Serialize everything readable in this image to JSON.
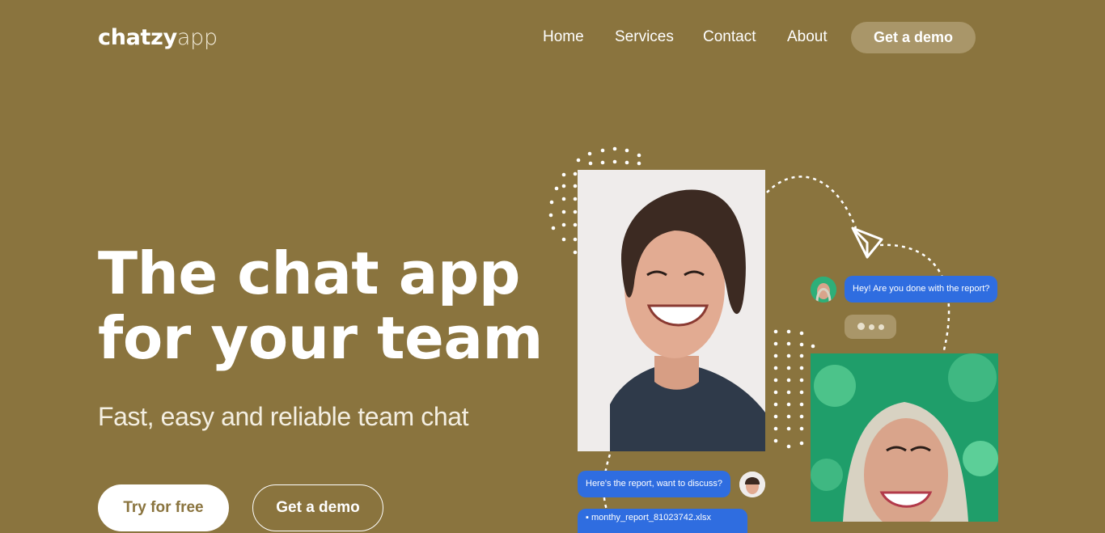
{
  "logo": {
    "bold": "chatzy",
    "light": "app"
  },
  "nav": {
    "links": [
      "Home",
      "Services",
      "Contact",
      "About"
    ],
    "cta": "Get a demo"
  },
  "hero": {
    "title_line1": "The chat app",
    "title_line2": "for your team",
    "subtitle": "Fast, easy and reliable team chat",
    "primary_button": "Try for free",
    "secondary_button": "Get a demo"
  },
  "chat": {
    "message_incoming": "Hey! Are you done with the report?",
    "message_outgoing": "Here's the report, want to discuss?",
    "file_name": "monthy_report_81023742.xlsx"
  },
  "colors": {
    "background": "#8a743e",
    "demo_button": "#a99669",
    "bubble": "#2f6de0",
    "text": "#ffffff"
  }
}
